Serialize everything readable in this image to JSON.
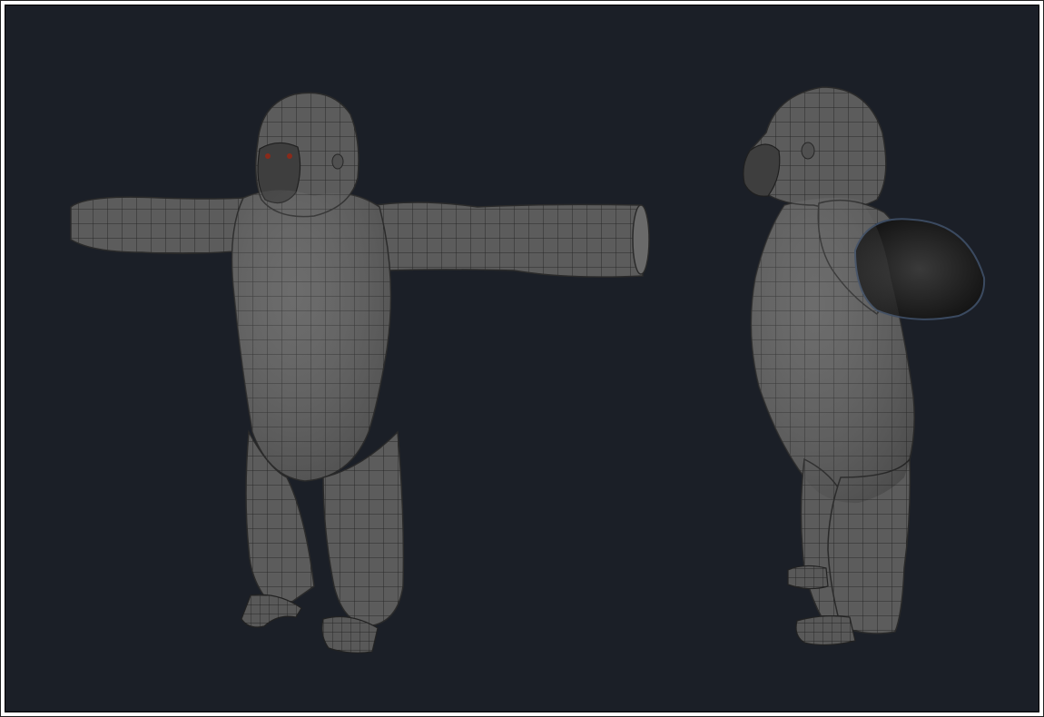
{
  "scene": {
    "background_color": "#1b1f27",
    "frame_color": "#ffffff",
    "mesh_fill_color": "#5c5c5c",
    "mesh_wire_color": "#262626",
    "eye_color": "#8a2a1a"
  },
  "views": [
    {
      "name": "front-three-quarter-view"
    },
    {
      "name": "side-view"
    }
  ]
}
